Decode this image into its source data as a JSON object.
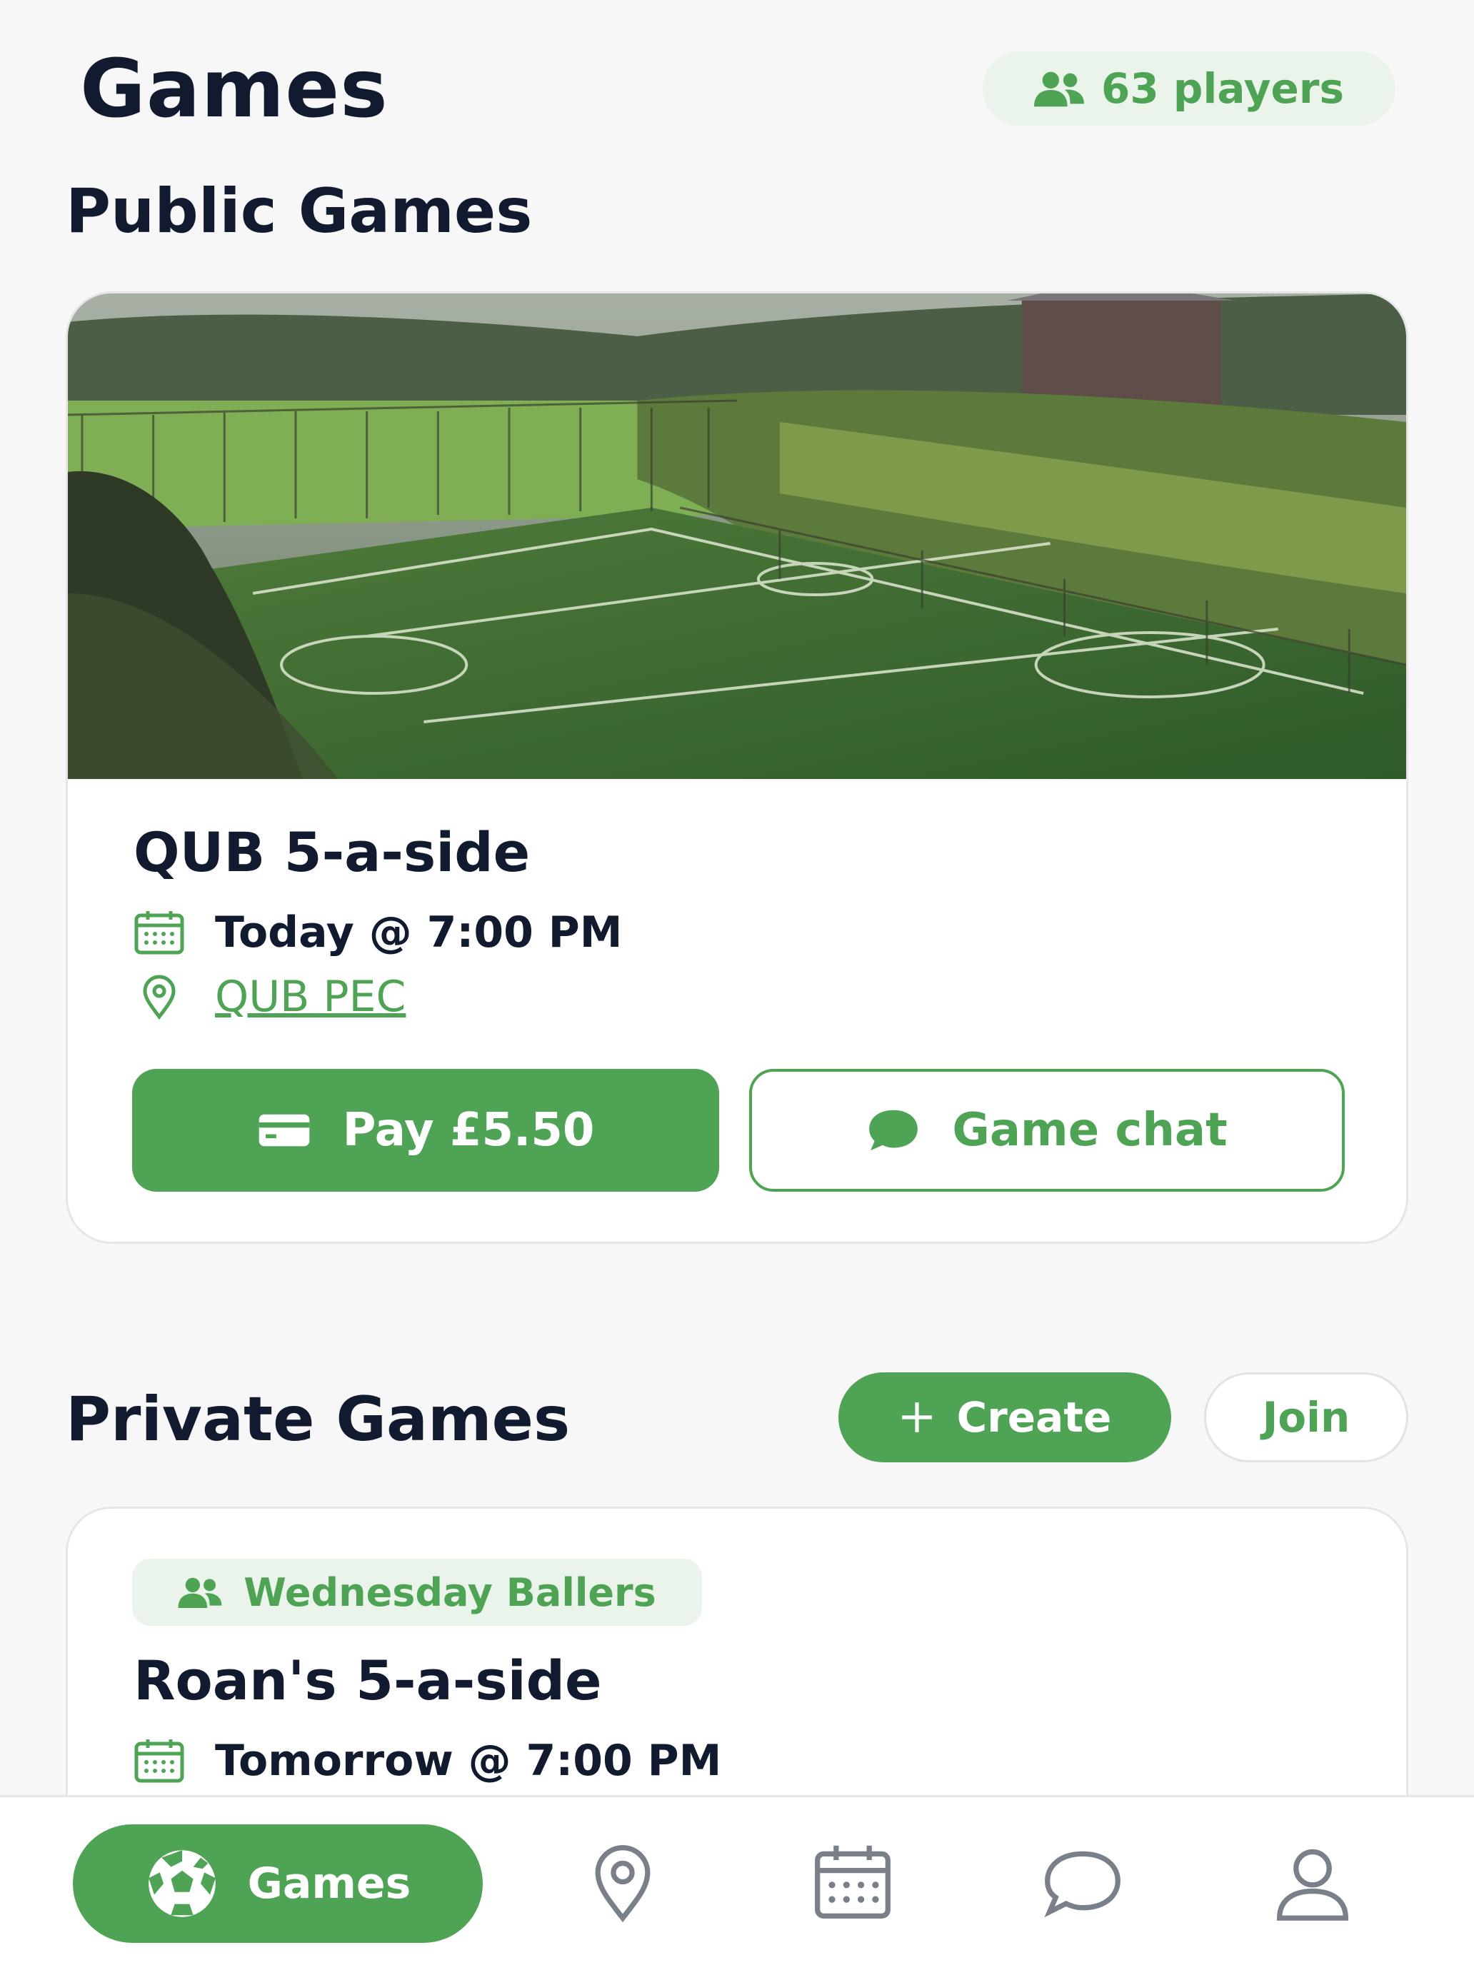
{
  "header": {
    "title": "Games",
    "players_count": "63 players",
    "players_icon": "people-icon"
  },
  "public_section": {
    "title": "Public Games",
    "game": {
      "title": "QUB 5-a-side",
      "image": "football-pitch-photo",
      "when": "Today @ 7:00 PM",
      "venue": "QUB PEC",
      "pay_label": "Pay £5.50",
      "chat_label": "Game chat"
    }
  },
  "private_section": {
    "title": "Private Games",
    "create_label": "Create",
    "join_label": "Join",
    "game": {
      "group": "Wednesday Ballers",
      "title": "Roan's 5-a-side",
      "when": "Tomorrow @ 7:00 PM"
    }
  },
  "bottom_nav": {
    "active_label": "Games",
    "items": [
      "games-icon",
      "map-pin-icon",
      "calendar-icon",
      "chat-icon",
      "user-icon"
    ]
  },
  "colors": {
    "accent": "#4fa355",
    "accent_light": "#eaf4ea",
    "text_dark": "#111a2e",
    "background": "#f7f7f7"
  }
}
